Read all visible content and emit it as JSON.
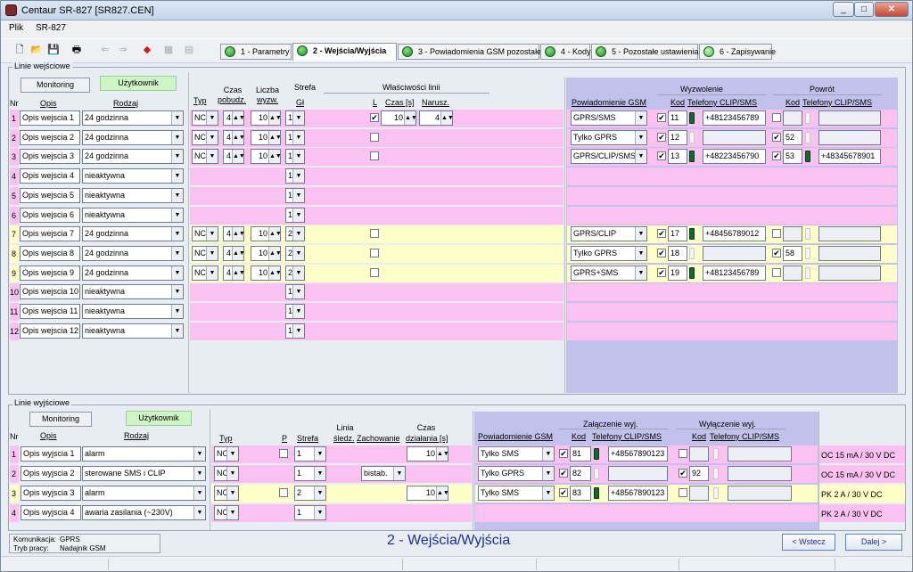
{
  "window": {
    "title": "Centaur SR-827  [SR827.CEN]"
  },
  "menu": [
    "Plik",
    "SR-827"
  ],
  "tabs": [
    {
      "label": "1 - Parametry",
      "active": false
    },
    {
      "label": "2 - Wejścia/Wyjścia",
      "active": true
    },
    {
      "label": "3 - Powiadomienia GSM pozostałe",
      "active": false
    },
    {
      "label": "4 - Kody",
      "active": false
    },
    {
      "label": "5 - Pozostałe ustawienia",
      "active": false
    },
    {
      "label": "6 - Zapisywanie",
      "active": false
    }
  ],
  "inputs": {
    "group_label": "Linie wejściowe",
    "btn_monitoring": "Monitoring",
    "btn_user": "Użytkownik",
    "h": {
      "nr": "Nr",
      "opis": "Opis",
      "rodzaj": "Rodzaj",
      "typ": "Typ",
      "czas1": "Czas",
      "czas2": "pobudz.",
      "liczba1": "Liczba",
      "liczba2": "wyzw.",
      "strefa": "Strefa",
      "gl": "Gł",
      "wlasc": "Właściwości linii",
      "l": "L",
      "czas_s": "Czas [s]",
      "narusz": "Narusz.",
      "powiad": "Powiadomienie GSM",
      "wyzw": "Wyzwolenie",
      "powrot": "Powrót",
      "kod": "Kod",
      "tel": "Telefony CLIP/SMS"
    },
    "rows": [
      {
        "nr": "1",
        "opis": "Opis wejscia 1",
        "rodzaj": "24 godzinna",
        "typ": "NC",
        "czas": "4",
        "liczba": "10",
        "strefa": "1",
        "l": true,
        "lczas": "10",
        "narusz": "4",
        "color": "pink",
        "gsm": "GPRS/SMS",
        "w_chk": true,
        "w_kod": "11",
        "w_ph": true,
        "w_tel": "+48123456789",
        "p_chk": false,
        "p_kod": "",
        "p_ph": false,
        "p_tel": ""
      },
      {
        "nr": "2",
        "opis": "Opis wejscia 2",
        "rodzaj": "24 godzinna",
        "typ": "NC",
        "czas": "4",
        "liczba": "10",
        "strefa": "1",
        "l": false,
        "lczas": "",
        "narusz": "",
        "color": "pink",
        "gsm": "Tylko GPRS",
        "w_chk": true,
        "w_kod": "12",
        "w_ph": false,
        "w_tel": "",
        "p_chk": true,
        "p_kod": "52",
        "p_ph": false,
        "p_tel": ""
      },
      {
        "nr": "3",
        "opis": "Opis wejscia 3",
        "rodzaj": "24 godzinna",
        "typ": "NC",
        "czas": "4",
        "liczba": "10",
        "strefa": "1",
        "l": false,
        "lczas": "",
        "narusz": "",
        "color": "pink",
        "gsm": "GPRS/CLIP/SMS",
        "w_chk": true,
        "w_kod": "13",
        "w_ph": true,
        "w_tel": "+48223456790",
        "p_chk": true,
        "p_kod": "53",
        "p_ph": true,
        "p_tel": "+48345678901"
      },
      {
        "nr": "4",
        "opis": "Opis wejscia 4",
        "rodzaj": "nieaktywna",
        "strefa": "1",
        "color": "pink",
        "empty": true
      },
      {
        "nr": "5",
        "opis": "Opis wejscia 5",
        "rodzaj": "nieaktywna",
        "strefa": "1",
        "color": "pink",
        "empty": true
      },
      {
        "nr": "6",
        "opis": "Opis wejscia 6",
        "rodzaj": "nieaktywna",
        "strefa": "1",
        "color": "pink",
        "empty": true
      },
      {
        "nr": "7",
        "opis": "Opis wejscia 7",
        "rodzaj": "24 godzinna",
        "typ": "NC",
        "czas": "4",
        "liczba": "10",
        "strefa": "2",
        "l": false,
        "lczas": "",
        "narusz": "",
        "color": "yel",
        "gsm": "GPRS/CLIP",
        "w_chk": true,
        "w_kod": "17",
        "w_ph": true,
        "w_tel": "+48456789012",
        "p_chk": false,
        "p_kod": "",
        "p_ph": false,
        "p_tel": ""
      },
      {
        "nr": "8",
        "opis": "Opis wejscia 8",
        "rodzaj": "24 godzinna",
        "typ": "NC",
        "czas": "4",
        "liczba": "10",
        "strefa": "2",
        "l": false,
        "lczas": "",
        "narusz": "",
        "color": "yel",
        "gsm": "Tylko GPRS",
        "w_chk": true,
        "w_kod": "18",
        "w_ph": false,
        "w_tel": "",
        "p_chk": true,
        "p_kod": "58",
        "p_ph": false,
        "p_tel": ""
      },
      {
        "nr": "9",
        "opis": "Opis wejscia 9",
        "rodzaj": "24 godzinna",
        "typ": "NC",
        "czas": "4",
        "liczba": "10",
        "strefa": "2",
        "l": false,
        "lczas": "",
        "narusz": "",
        "color": "yel",
        "gsm": "GPRS+SMS",
        "w_chk": true,
        "w_kod": "19",
        "w_ph": true,
        "w_tel": "+48123456789",
        "p_chk": false,
        "p_kod": "",
        "p_ph": false,
        "p_tel": ""
      },
      {
        "nr": "10",
        "opis": "Opis wejscia 10",
        "rodzaj": "nieaktywna",
        "strefa": "1",
        "color": "pink",
        "empty": true
      },
      {
        "nr": "11",
        "opis": "Opis wejscia 11",
        "rodzaj": "nieaktywna",
        "strefa": "1",
        "color": "pink",
        "empty": true
      },
      {
        "nr": "12",
        "opis": "Opis wejscia 12",
        "rodzaj": "nieaktywna",
        "strefa": "1",
        "color": "pink",
        "empty": true
      }
    ]
  },
  "outputs": {
    "group_label": "Linie wyjściowe",
    "btn_monitoring": "Monitoring",
    "btn_user": "Użytkownik",
    "h": {
      "nr": "Nr",
      "opis": "Opis",
      "rodzaj": "Rodzaj",
      "typ": "Typ",
      "p": "P",
      "strefa": "Strefa",
      "linia1": "Linia",
      "linia2": "śledz.",
      "zach": "Zachowanie",
      "czas1": "Czas",
      "czas2": "działania [s]",
      "powiad": "Powiadomienie GSM",
      "zal": "Załączenie wyj.",
      "wyl": "Wyłączenie wyj.",
      "kod": "Kod",
      "tel": "Telefony CLIP/SMS"
    },
    "rows": [
      {
        "nr": "1",
        "opis": "Opis wyjscia 1",
        "rodzaj": "alarm",
        "typ": "NO",
        "p": false,
        "strefa": "1",
        "zach": "",
        "czas": "10",
        "color": "pink",
        "gsm": "Tylko SMS",
        "z_chk": true,
        "z_kod": "81",
        "z_ph": true,
        "z_tel": "+48567890123",
        "y_chk": false,
        "y_kod": "",
        "y_ph": false,
        "y_tel": "",
        "info": "OC 15 mA / 30 V DC"
      },
      {
        "nr": "2",
        "opis": "Opis wyjscia 2",
        "rodzaj": "sterowane SMS i CLIP",
        "typ": "NO",
        "p": null,
        "strefa": "1",
        "zach": "bistab.",
        "czas": "",
        "color": "pink",
        "gsm": "Tylko GPRS",
        "z_chk": true,
        "z_kod": "82",
        "z_ph": false,
        "z_tel": "",
        "y_chk": true,
        "y_kod": "92",
        "y_ph": false,
        "y_tel": "",
        "info": "OC 15 mA / 30 V DC"
      },
      {
        "nr": "3",
        "opis": "Opis wyjscia 3",
        "rodzaj": "alarm",
        "typ": "NO",
        "p": false,
        "strefa": "2",
        "zach": "",
        "czas": "10",
        "color": "yel",
        "gsm": "Tylko SMS",
        "z_chk": true,
        "z_kod": "83",
        "z_ph": true,
        "z_tel": "+48567890123",
        "y_chk": false,
        "y_kod": "",
        "y_ph": false,
        "y_tel": "",
        "info": "PK 2 A / 30 V DC"
      },
      {
        "nr": "4",
        "opis": "Opis wyjscia 4",
        "rodzaj": "awaria zasilania (~230V)",
        "typ": "NO",
        "p": null,
        "strefa": "1",
        "zach": "",
        "czas": "",
        "color": "pink",
        "empty": true,
        "info": "PK 2 A / 30 V DC"
      }
    ]
  },
  "status": {
    "kom_label": "Komunikacja:",
    "kom_val": "GPRS",
    "tryb_label": "Tryb pracy:",
    "tryb_val": "Nadajnik GSM"
  },
  "page_title": "2 - Wejścia/Wyjścia",
  "nav": {
    "back": "< Wstecz",
    "next": "Dalej >"
  }
}
